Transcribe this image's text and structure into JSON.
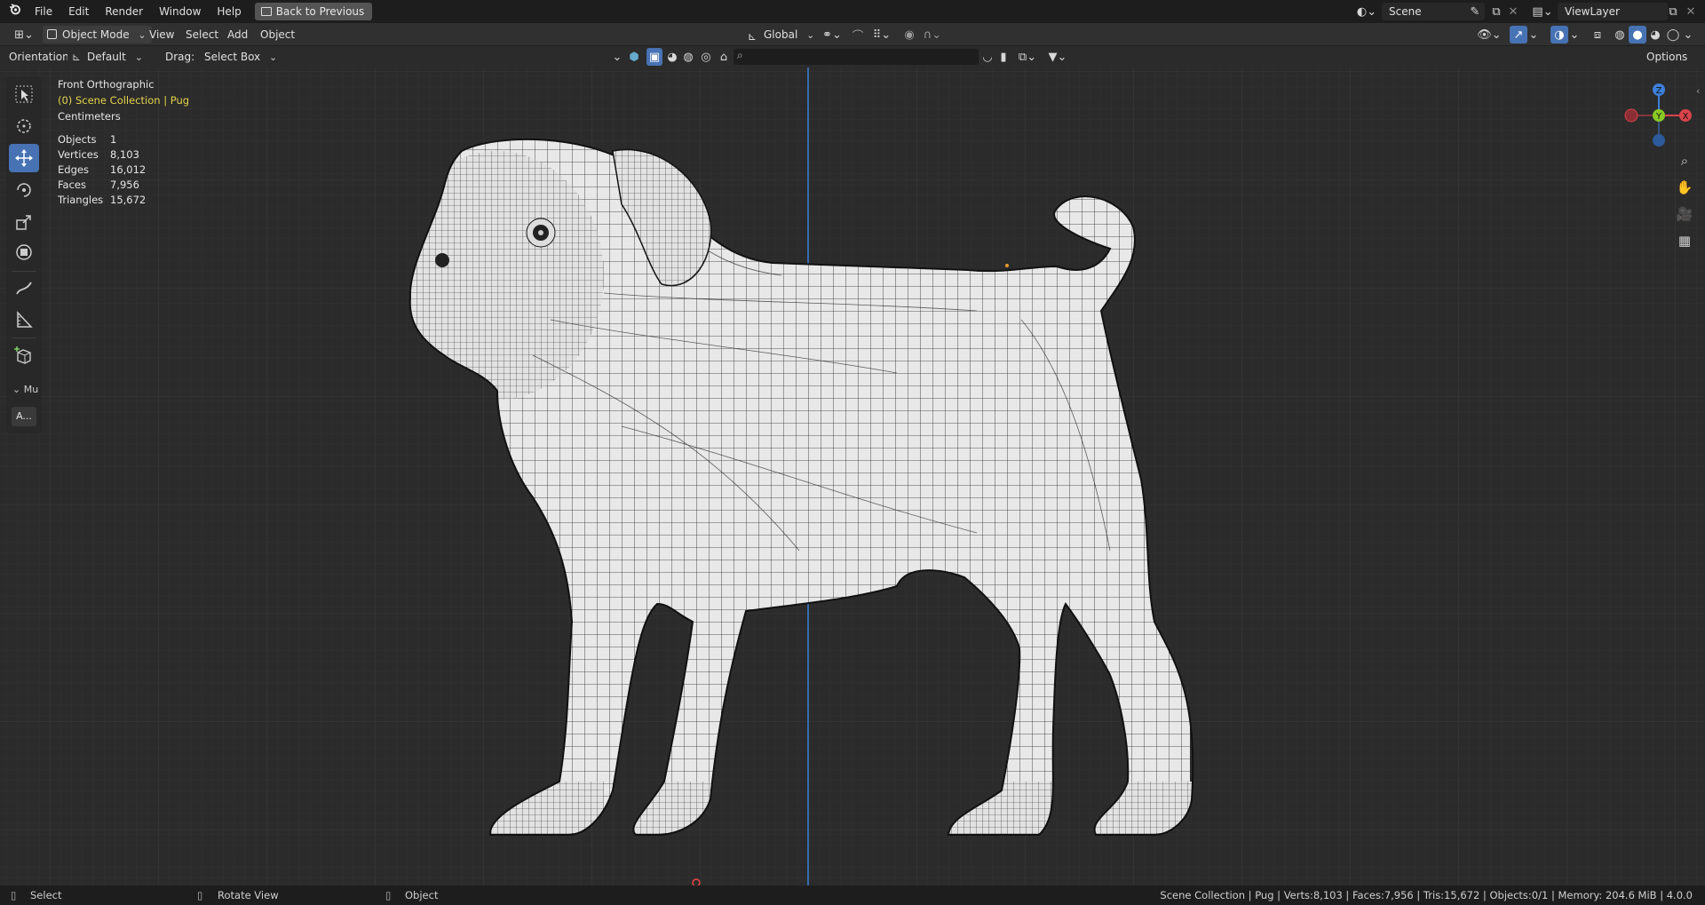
{
  "menubar": {
    "items": [
      "File",
      "Edit",
      "Render",
      "Window",
      "Help"
    ],
    "back_button": "Back to Previous",
    "scene_label": "Scene",
    "viewlayer_label": "ViewLayer"
  },
  "header": {
    "mode": "Object Mode",
    "menus": [
      "View",
      "Select",
      "Add",
      "Object"
    ],
    "transform_orientation": "Global"
  },
  "toolsettings": {
    "orientation_label": "Orientation:",
    "orientation_value": "Default",
    "drag_label": "Drag:",
    "drag_value": "Select Box",
    "options_label": "Options"
  },
  "viewport": {
    "view_name": "Front Orthographic",
    "collection": "(0) Scene Collection | Pug",
    "units": "Centimeters",
    "stats": [
      {
        "label": "Objects",
        "value": "1"
      },
      {
        "label": "Vertices",
        "value": "8,103"
      },
      {
        "label": "Edges",
        "value": "16,012"
      },
      {
        "label": "Faces",
        "value": "7,956"
      },
      {
        "label": "Triangles",
        "value": "15,672"
      }
    ],
    "gizmo": {
      "z": "Z",
      "y": "Y",
      "x": "X"
    }
  },
  "toolbar": {
    "collapsed_label": "Mu",
    "collapsed_button": "A..."
  },
  "statusbar": {
    "left_select": "Select",
    "left_rotate": "Rotate View",
    "left_object": "Object",
    "right_info": "Scene Collection | Pug | Verts:8,103 | Faces:7,956 | Tris:15,672 | Objects:0/1 | Memory: 204.6 MiB | 4.0.0"
  },
  "colors": {
    "accent": "#4772b3",
    "collection_text": "#e4d34a",
    "axis_x": "#d9434a",
    "axis_y": "#8ac926",
    "axis_z": "#3d7fd9",
    "mesh_fill": "#e8e8e8"
  }
}
